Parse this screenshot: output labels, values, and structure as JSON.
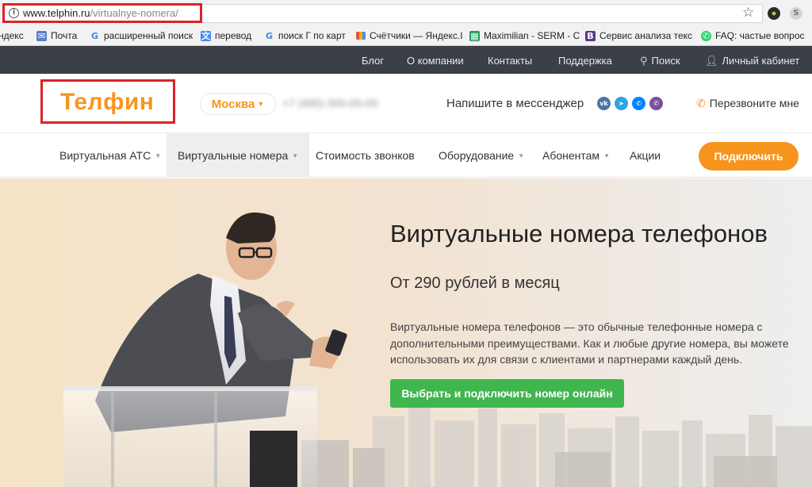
{
  "browser": {
    "url_host": "www.telphin.ru",
    "url_path": "/virtualnye-nomera/",
    "info_glyph": "i",
    "star_glyph": "☆",
    "bookmarks": [
      {
        "label": "ндекс",
        "icon": "none"
      },
      {
        "label": "Почта",
        "icon": "mail-icon",
        "color": "#5b7fc9"
      },
      {
        "label": "расширенный поиск",
        "icon": "google-icon",
        "color": "#4285f4"
      },
      {
        "label": "перевод",
        "icon": "translate-icon",
        "color": "#4a8af4"
      },
      {
        "label": "поиск Г по карт",
        "icon": "google-icon",
        "color": "#4285f4"
      },
      {
        "label": "Счётчики — Яндекс.І",
        "icon": "metrica-icon",
        "color": "#e94e3c"
      },
      {
        "label": "Maximilian - SERM - С",
        "icon": "sheets-icon",
        "color": "#1e9e57"
      },
      {
        "label": "Сервис анализа текс",
        "icon": "b-icon",
        "color": "#5b3a8c"
      },
      {
        "label": "FAQ: частые вопрос",
        "icon": "whatsapp-icon",
        "color": "#25d366"
      }
    ]
  },
  "topbar": {
    "items": [
      "Блог",
      "О компании",
      "Контакты",
      "Поддержка"
    ],
    "search": "Поиск",
    "account": "Личный кабинет"
  },
  "header": {
    "logo": "Телфин",
    "city": "Москва",
    "messenger_label": "Напишите в мессенджер",
    "messengers": [
      {
        "name": "vk-icon",
        "glyph": "vk",
        "color": "#4a76a8"
      },
      {
        "name": "telegram-icon",
        "glyph": "➤",
        "color": "#2ca5e0"
      },
      {
        "name": "messenger-icon",
        "glyph": "✆",
        "color": "#0084ff"
      },
      {
        "name": "viber-icon",
        "glyph": "✆",
        "color": "#7b519d"
      }
    ],
    "callback": "Перезвоните мне"
  },
  "nav": {
    "items": [
      {
        "label": "Виртуальная АТС",
        "dropdown": true
      },
      {
        "label": "Виртуальные номера",
        "dropdown": true,
        "active": true
      },
      {
        "label": "Стоимость звонков",
        "dropdown": false
      },
      {
        "label": "Оборудование",
        "dropdown": true
      },
      {
        "label": "Абонентам",
        "dropdown": true
      },
      {
        "label": "Акции",
        "dropdown": false
      }
    ],
    "cta": "Подключить"
  },
  "hero": {
    "title": "Виртуальные номера телефонов",
    "price": "От 290 рублей в месяц",
    "description": "Виртуальные номера телефонов — это обычные телефонные номера с дополнительными преимуществами. Как и любые другие номера, вы можете использовать их для связи с клиентами и партнерами каждый день.",
    "button": "Выбрать и подключить номер онлайн"
  },
  "colors": {
    "brand_orange": "#f79521",
    "topbar_bg": "#3b3f46",
    "cta_green": "#3fb64e",
    "highlight_red": "#d9232a"
  }
}
